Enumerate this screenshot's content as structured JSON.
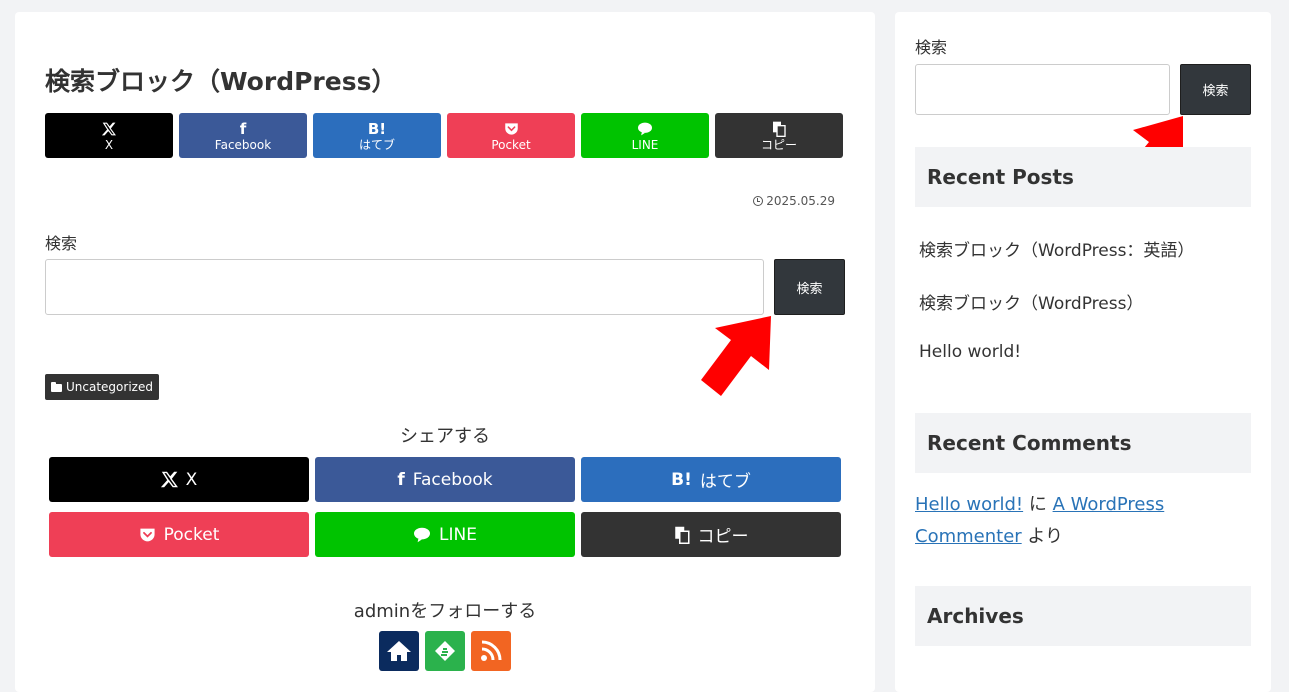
{
  "post": {
    "title": "検索ブロック（WordPress）",
    "date": "2025.05.29",
    "category": "Uncategorized"
  },
  "sns_top": [
    {
      "label": "X",
      "icon": "x-icon",
      "color": "#000000"
    },
    {
      "label": "Facebook",
      "icon": "facebook-icon",
      "color": "#3b5998"
    },
    {
      "label": "はてブ",
      "icon": "hatena-icon",
      "color": "#2c6ebd"
    },
    {
      "label": "Pocket",
      "icon": "pocket-icon",
      "color": "#ef3f56"
    },
    {
      "label": "LINE",
      "icon": "line-icon",
      "color": "#00c300"
    },
    {
      "label": "コピー",
      "icon": "copy-icon",
      "color": "#333333"
    }
  ],
  "main_search": {
    "label": "検索",
    "value": "",
    "button": "検索"
  },
  "share": {
    "title": "シェアする",
    "buttons": [
      {
        "label": "X",
        "icon": "x-icon"
      },
      {
        "label": "Facebook",
        "icon": "facebook-icon"
      },
      {
        "label": "はてブ",
        "icon": "hatena-icon"
      },
      {
        "label": "Pocket",
        "icon": "pocket-icon"
      },
      {
        "label": "LINE",
        "icon": "line-icon"
      },
      {
        "label": "コピー",
        "icon": "copy-icon"
      }
    ]
  },
  "follow": {
    "title": "adminをフォローする",
    "buttons": [
      {
        "icon": "home-icon",
        "color": "#0b2b5e"
      },
      {
        "icon": "feedly-icon",
        "color": "#2bb24c"
      },
      {
        "icon": "rss-icon",
        "color": "#f26522"
      }
    ]
  },
  "sidebar": {
    "search": {
      "label": "検索",
      "value": "",
      "button": "検索"
    },
    "recent_posts": {
      "title": "Recent Posts",
      "items": [
        "検索ブロック（WordPress：英語）",
        "検索ブロック（WordPress）",
        "Hello world!"
      ]
    },
    "recent_comments": {
      "title": "Recent Comments",
      "post_link": "Hello world!",
      "connector": " に ",
      "author_link": "A WordPress Commenter",
      "suffix": " より"
    },
    "archives": {
      "title": "Archives"
    }
  },
  "colors": {
    "accent_red": "#ff0000",
    "button_dark": "#32373c",
    "link": "#2973b7"
  }
}
